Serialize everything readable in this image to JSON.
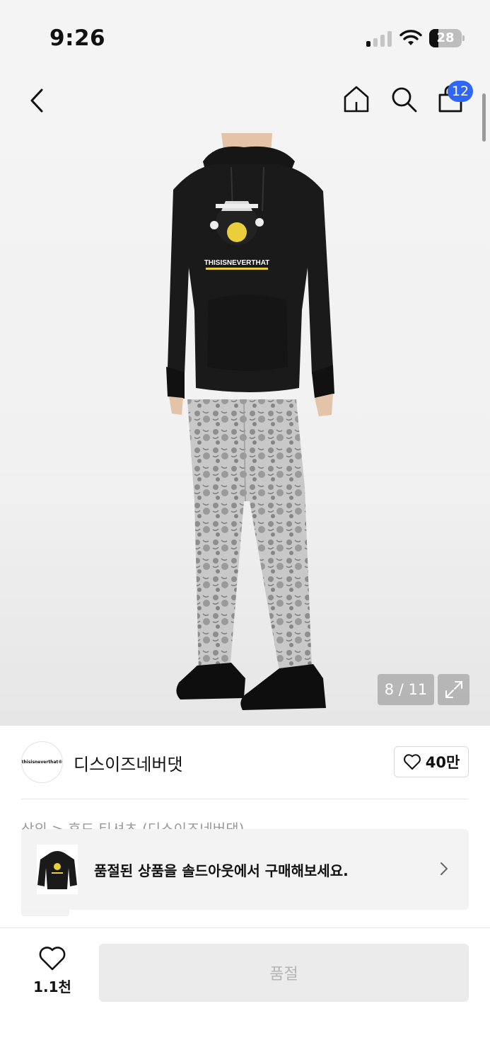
{
  "status_bar": {
    "time": "9:26",
    "battery": "28",
    "battery_level": 0.28
  },
  "header": {
    "cart_badge": "12"
  },
  "gallery": {
    "counter": "8 / 11",
    "print_text": "THISISNEVERTHAT"
  },
  "brand": {
    "logo_text": "thisisneverthat®",
    "name": "디스이즈네버댓",
    "likes": "40만"
  },
  "breadcrumb": "상의 > 후드 티셔츠 (디스이즈네버댓)",
  "banner": {
    "text": "품절된 상품을 솔드아웃에서 구매해보세요."
  },
  "bottom_bar": {
    "wish_count": "1.1천",
    "buy_label": "품절"
  },
  "colors": {
    "accent": "#2f66f6",
    "disabled_bg": "#ebebeb",
    "disabled_text": "#b4b4b4"
  }
}
